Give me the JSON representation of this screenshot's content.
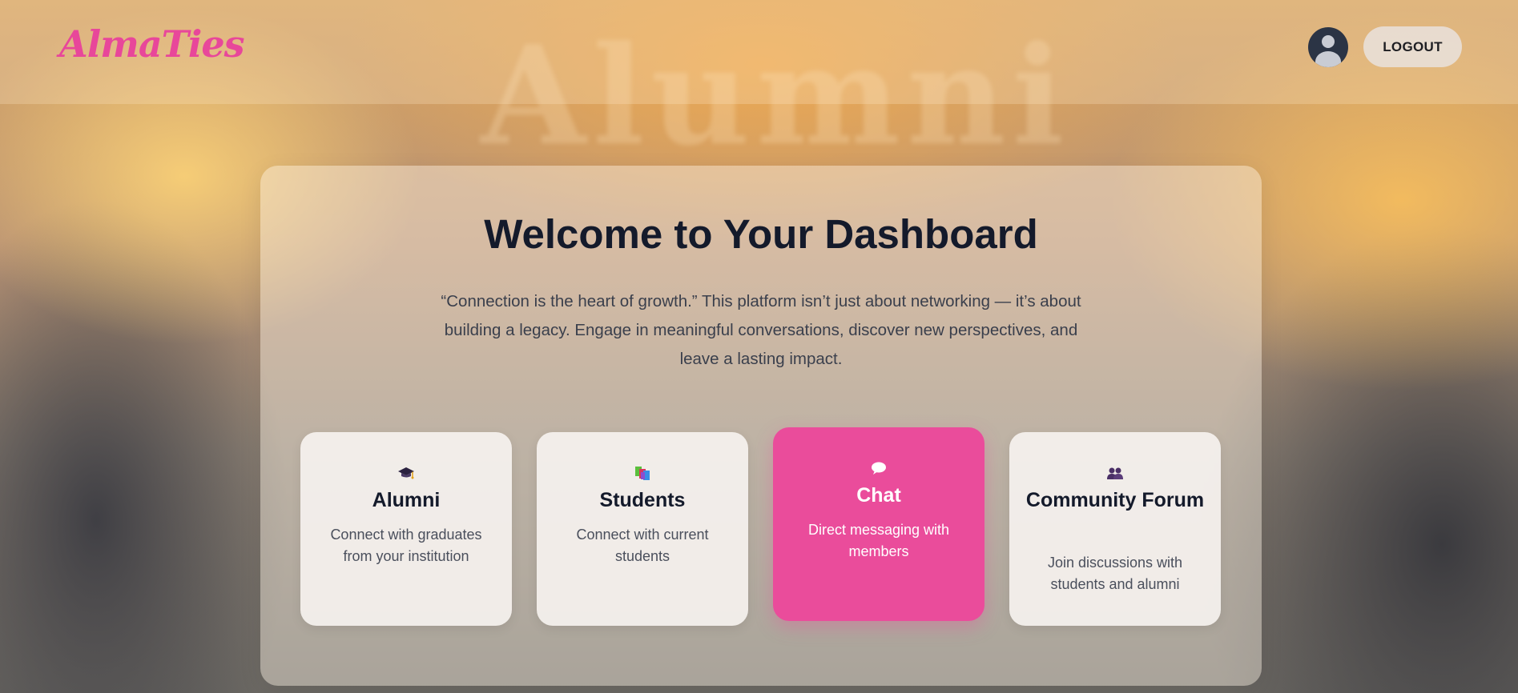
{
  "header": {
    "logo": "AlmaTies",
    "logout_label": "LOGOUT"
  },
  "background": {
    "word": "Alumni"
  },
  "main": {
    "title": "Welcome to Your Dashboard",
    "quote": "“Connection is the heart of growth.” This platform isn’t just about networking — it’s about building a legacy. Engage in meaningful conversations, discover new perspectives, and leave a lasting impact."
  },
  "cards": [
    {
      "title": "Alumni",
      "description": "Connect with graduates from your institution",
      "icon": "graduation-cap-icon",
      "active": false
    },
    {
      "title": "Students",
      "description": "Connect with current students",
      "icon": "books-icon",
      "active": false
    },
    {
      "title": "Chat",
      "description": "Direct messaging with members",
      "icon": "speech-bubble-icon",
      "active": true
    },
    {
      "title": "Community Forum",
      "description": "Join discussions with students and alumni",
      "icon": "people-icon",
      "active": false
    }
  ],
  "colors": {
    "brand": "#e8479a",
    "active_card": "#ea4c9b",
    "title_text": "#141a2b"
  }
}
